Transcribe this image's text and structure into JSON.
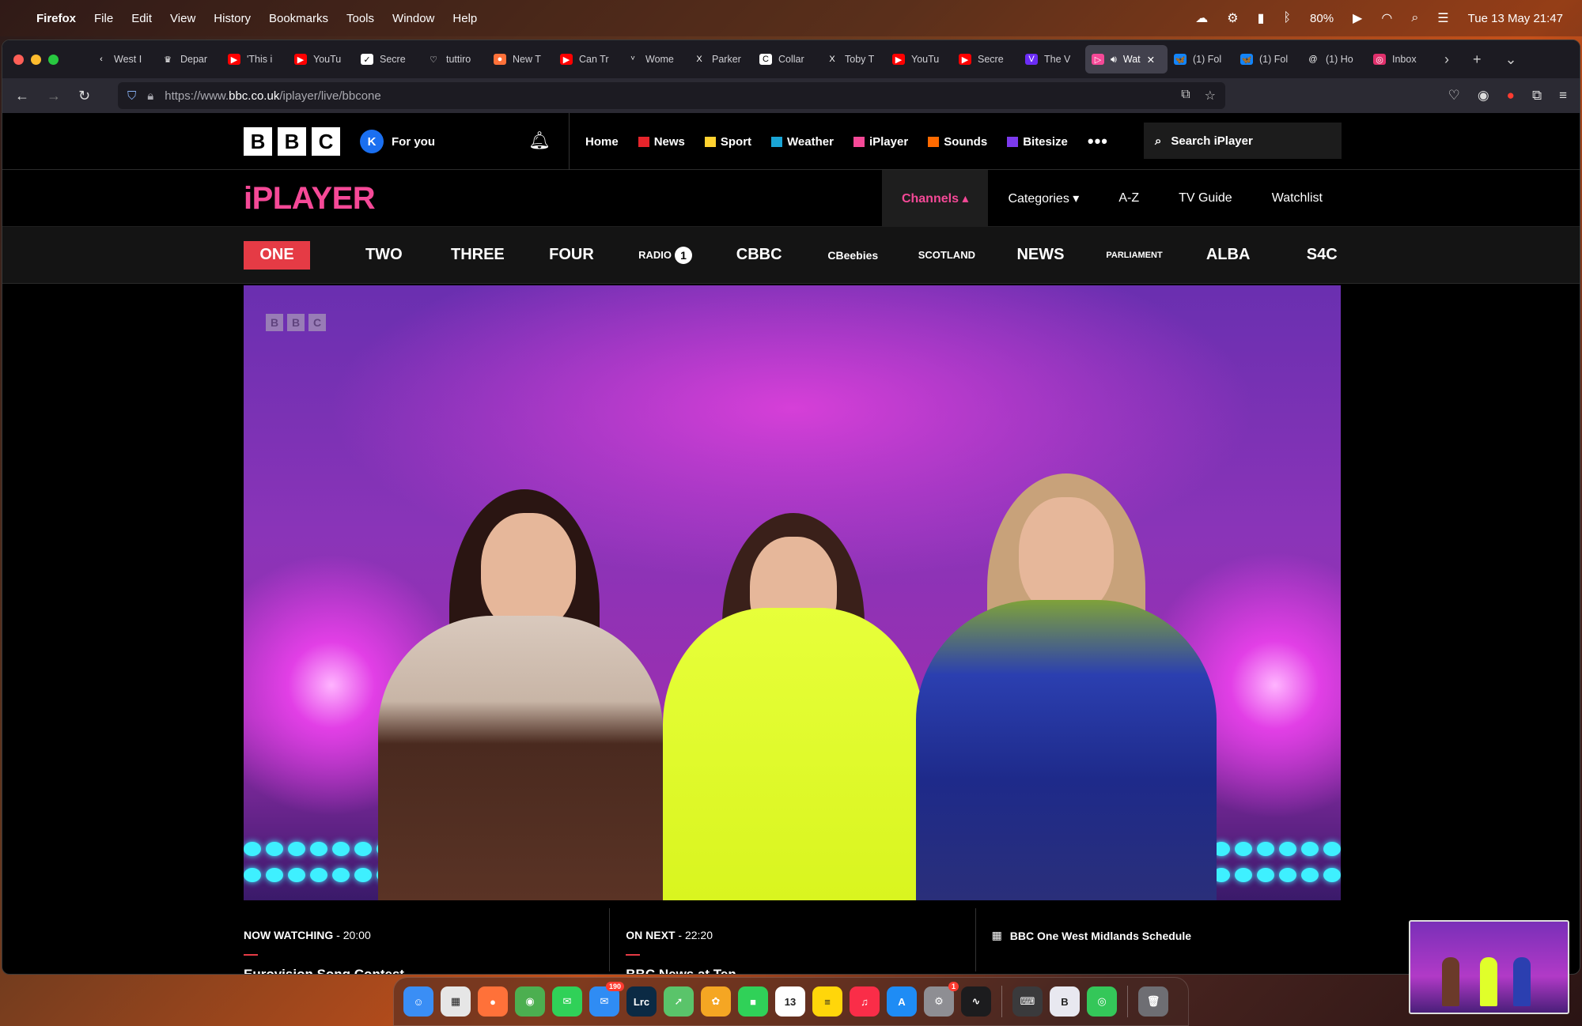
{
  "menubar": {
    "app": "Firefox",
    "items": [
      "File",
      "Edit",
      "View",
      "History",
      "Bookmarks",
      "Tools",
      "Window",
      "Help"
    ],
    "battery": "80%",
    "datetime": "Tue 13 May  21:47"
  },
  "browser": {
    "tabs": [
      {
        "label": "West I",
        "fav": "‹",
        "color": "transparent"
      },
      {
        "label": "Depar",
        "fav": "♛",
        "color": "transparent"
      },
      {
        "label": "'This i",
        "fav": "▶",
        "color": "#ff0000"
      },
      {
        "label": "YouTu",
        "fav": "▶",
        "color": "#ff0000"
      },
      {
        "label": "Secre",
        "fav": "✓",
        "color": "#ffffff"
      },
      {
        "label": "tuttiro",
        "fav": "♡",
        "color": "transparent"
      },
      {
        "label": "New T",
        "fav": "●",
        "color": "#ff7139"
      },
      {
        "label": "Can Tr",
        "fav": "▶",
        "color": "#ff0000"
      },
      {
        "label": "Wome",
        "fav": "ⱽ",
        "color": "transparent"
      },
      {
        "label": "Parker",
        "fav": "X",
        "color": "transparent"
      },
      {
        "label": "Collar",
        "fav": "C",
        "color": "#ffffff"
      },
      {
        "label": "Toby T",
        "fav": "X",
        "color": "transparent"
      },
      {
        "label": "YouTu",
        "fav": "▶",
        "color": "#ff0000"
      },
      {
        "label": "Secre",
        "fav": "▶",
        "color": "#ff0000"
      },
      {
        "label": "The V",
        "fav": "V",
        "color": "#6b2cf5"
      },
      {
        "label": "Wat",
        "fav": "▷",
        "color": "#f54997",
        "active": true
      },
      {
        "label": "(1) Fol",
        "fav": "🦋",
        "color": "#1185fe"
      },
      {
        "label": "(1) Fol",
        "fav": "🦋",
        "color": "#1185fe"
      },
      {
        "label": "(1) Ho",
        "fav": "@",
        "color": "transparent"
      },
      {
        "label": "Inbox",
        "fav": "◎",
        "color": "#e1306c"
      }
    ],
    "url_prefix": "https://www.",
    "url_domain": "bbc.co.uk",
    "url_path": "/iplayer/live/bbcone"
  },
  "bbc": {
    "logo": [
      "B",
      "B",
      "C"
    ],
    "avatar_letter": "K",
    "for_you": "For you",
    "nav": [
      {
        "label": "Home",
        "color": "transparent"
      },
      {
        "label": "News",
        "color": "#e5242b"
      },
      {
        "label": "Sport",
        "color": "#ffd230"
      },
      {
        "label": "Weather",
        "color": "#1aa5d6"
      },
      {
        "label": "iPlayer",
        "color": "#f54997"
      },
      {
        "label": "Sounds",
        "color": "#ff6a00"
      },
      {
        "label": "Bitesize",
        "color": "#7c3aed"
      }
    ],
    "more": "•••",
    "search_placeholder": "Search iPlayer"
  },
  "iplayer": {
    "logo": "iPLAYER",
    "menu": [
      "Channels ▴",
      "Categories ▾",
      "A-Z",
      "TV Guide",
      "Watchlist"
    ],
    "channels": [
      "ONE",
      "TWO",
      "THREE",
      "FOUR",
      "RADIO",
      "CBBC",
      "CBeebies",
      "SCOTLAND",
      "NEWS",
      "PARLIAMENT",
      "ALBA",
      "S4C"
    ],
    "radio_badge": "1"
  },
  "player": {
    "watermark": [
      "B",
      "B",
      "C"
    ]
  },
  "info": {
    "now_label": "NOW WATCHING",
    "now_time": " - 20:00",
    "now_title": "Eurovision Song Contest",
    "next_label": "ON NEXT",
    "next_time": " - 22:20",
    "next_title": "BBC News at Ten",
    "schedule": "BBC One West Midlands Schedule"
  },
  "dock": {
    "apps": [
      {
        "name": "Finder",
        "short": "☺",
        "color": "#3a8ef5"
      },
      {
        "name": "Launchpad",
        "short": "▦",
        "color": "#e6e6e6"
      },
      {
        "name": "Firefox",
        "short": "●",
        "color": "#ff7139"
      },
      {
        "name": "Chrome",
        "short": "◉",
        "color": "#4caf50"
      },
      {
        "name": "Messages",
        "short": "✉",
        "color": "#30d158"
      },
      {
        "name": "Mail",
        "short": "✉",
        "color": "#2f8cf4",
        "badge": "190"
      },
      {
        "name": "Lightroom",
        "short": "Lrc",
        "color": "#0b2a44"
      },
      {
        "name": "Maps",
        "short": "➚",
        "color": "#5ac46a"
      },
      {
        "name": "Photos",
        "short": "✿",
        "color": "#f5a623"
      },
      {
        "name": "FaceTime",
        "short": "■",
        "color": "#30d158"
      },
      {
        "name": "Calendar",
        "short": "13",
        "color": "#ffffff"
      },
      {
        "name": "Notes",
        "short": "≡",
        "color": "#ffd60a"
      },
      {
        "name": "Music",
        "short": "♫",
        "color": "#fa2d48"
      },
      {
        "name": "App Store",
        "short": "A",
        "color": "#1e8cf5"
      },
      {
        "name": "System Settings",
        "short": "⚙",
        "color": "#8e8e93",
        "badge": "1"
      },
      {
        "name": "Activity Monitor",
        "short": "∿",
        "color": "#1c1c1e"
      },
      {
        "name": "Keyboard",
        "short": "⌨",
        "color": "#3a3a3c"
      },
      {
        "name": "BBEdit",
        "short": "B",
        "color": "#e8e8f0"
      },
      {
        "name": "Find My",
        "short": "◎",
        "color": "#34c759"
      },
      {
        "name": "Trash",
        "short": "🗑",
        "color": "#6e6e73"
      }
    ]
  }
}
